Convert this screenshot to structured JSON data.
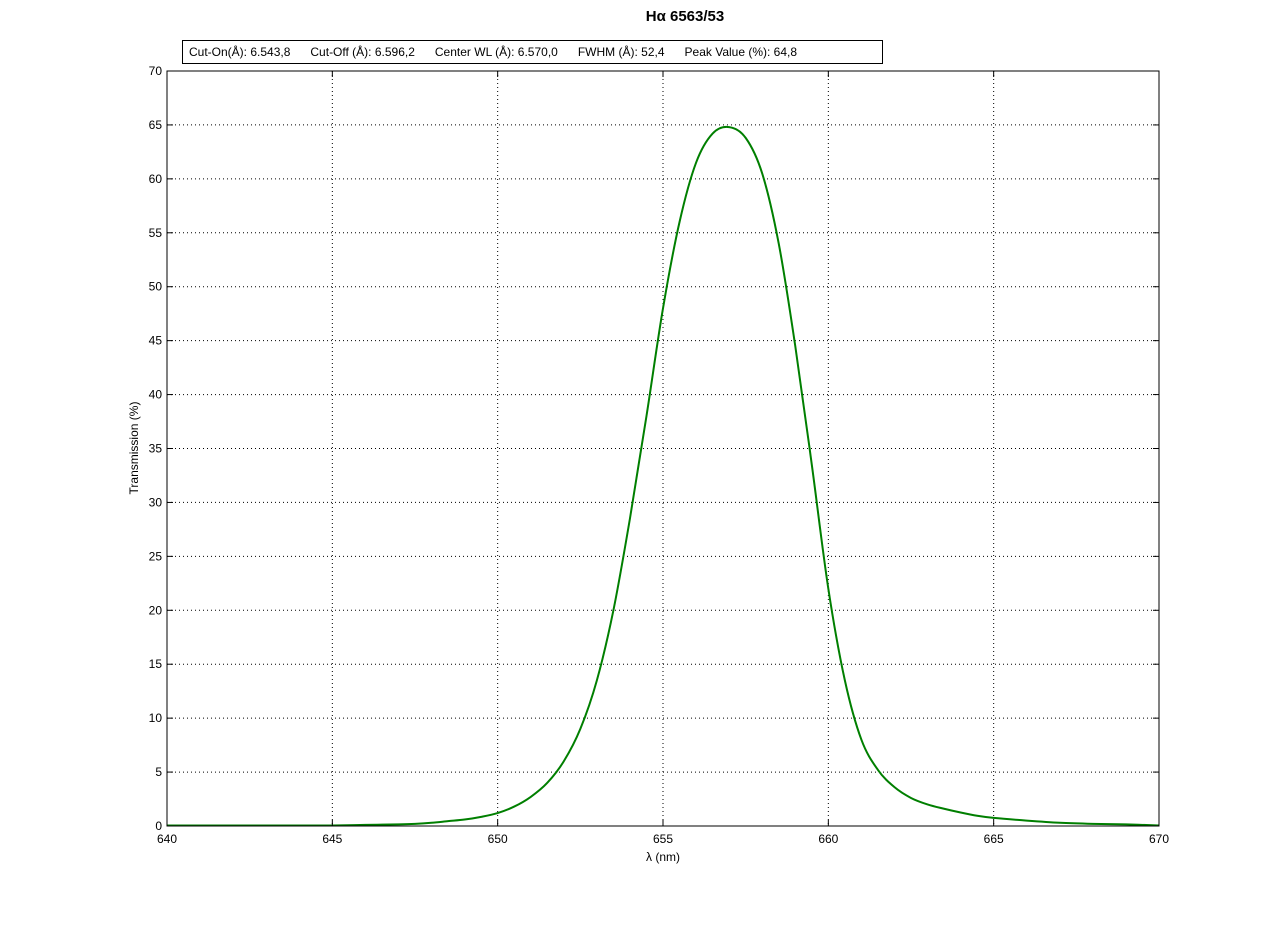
{
  "chart_data": {
    "type": "line",
    "title": "Hα 6563/53",
    "xlabel": "λ (nm)",
    "ylabel": "Transmission (%)",
    "xlim": [
      640,
      670
    ],
    "ylim": [
      0,
      70
    ],
    "xticks": [
      640,
      645,
      650,
      655,
      660,
      665,
      670
    ],
    "yticks": [
      0,
      5,
      10,
      15,
      20,
      25,
      30,
      35,
      40,
      45,
      50,
      55,
      60,
      65,
      70
    ],
    "grid": true,
    "grid_style": "dotted",
    "info": [
      "Cut-On(Å): 6.543,8",
      "Cut-Off (Å): 6.596,2",
      "Center WL (Å): 6.570,0",
      "FWHM (Å): 52,4",
      "Peak Value (%): 64,8"
    ],
    "series": [
      {
        "color": "#007f00",
        "x": [
          640,
          641,
          642,
          643,
          644,
          645,
          646,
          647,
          647.5,
          648,
          648.5,
          649,
          649.5,
          650,
          650.5,
          651,
          651.5,
          652,
          652.5,
          653,
          653.5,
          654,
          654.5,
          655,
          655.5,
          656,
          656.5,
          657,
          657.5,
          658,
          658.5,
          659,
          659.5,
          660,
          660.5,
          661,
          661.5,
          662,
          662.5,
          663,
          663.5,
          664,
          664.5,
          665,
          666,
          667,
          668,
          669,
          670
        ],
        "y": [
          0.05,
          0.05,
          0.05,
          0.05,
          0.05,
          0.05,
          0.1,
          0.15,
          0.2,
          0.3,
          0.45,
          0.6,
          0.85,
          1.2,
          1.8,
          2.7,
          4.0,
          6.0,
          9.0,
          13.5,
          20.0,
          28.5,
          38.0,
          48.0,
          56.0,
          61.5,
          64.2,
          64.8,
          63.8,
          60.5,
          54.0,
          44.5,
          33.5,
          22.0,
          13.5,
          8.0,
          5.2,
          3.6,
          2.6,
          2.0,
          1.6,
          1.25,
          0.95,
          0.75,
          0.5,
          0.3,
          0.2,
          0.15,
          0.05
        ]
      }
    ]
  }
}
